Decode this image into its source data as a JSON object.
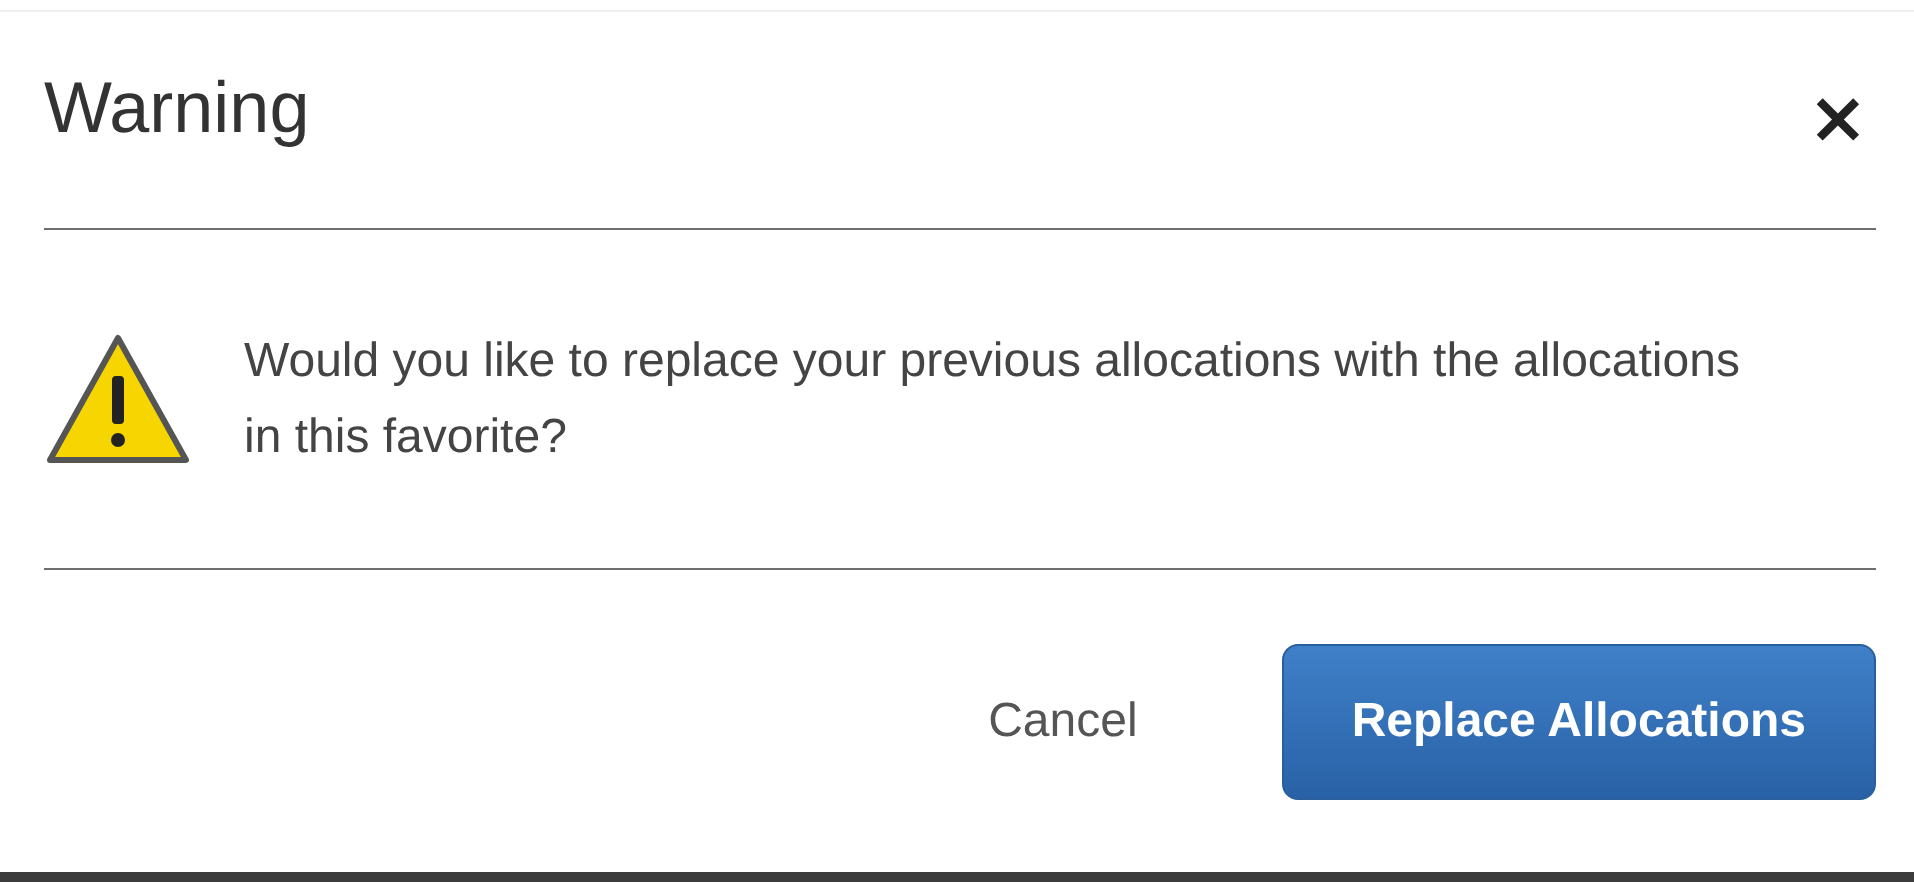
{
  "dialog": {
    "title": "Warning",
    "close": "×",
    "message": "Would you like to replace your previous allocations with the allocations in this favorite?",
    "buttons": [
      {
        "label": "Cancel",
        "kind": "secondary"
      },
      {
        "label": "Replace Allocations",
        "kind": "primary"
      }
    ]
  }
}
